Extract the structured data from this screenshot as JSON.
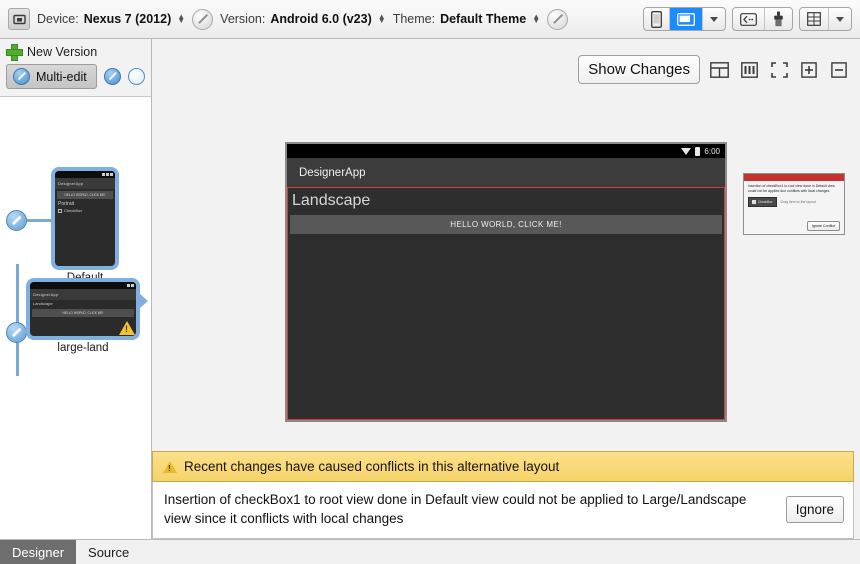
{
  "toolbar": {
    "device_label": "Device:",
    "device_value": "Nexus 7 (2012)",
    "version_label": "Version:",
    "version_value": "Android 6.0 (v23)",
    "theme_label": "Theme:",
    "theme_value": "Default Theme",
    "icons": {
      "device_chooser": "device-icon",
      "version_disabled": "no-entry-icon",
      "theme_disabled": "no-entry-icon",
      "portrait": "portrait-orientation-icon",
      "landscape": "landscape-orientation-icon",
      "orientation_more": "chevron-down-icon",
      "back_nav": "back-navigation-icon",
      "brush": "brush-icon",
      "grid": "grid-icon",
      "grid_more": "chevron-down-icon"
    }
  },
  "sidebar": {
    "new_version_label": "New Version",
    "multi_edit_label": "Multi-edit",
    "variants": [
      {
        "name": "Default",
        "app_title": "DesignerApp",
        "button_text": "HELLO WORLD, CLICK ME!",
        "text": "Portrait",
        "checkbox_label": "CheckBox",
        "has_warning": false
      },
      {
        "name": "large-land",
        "app_title": "DesignerApp",
        "text": "Landscape",
        "button_text": "HELLO WORLD, CLICK ME!",
        "has_warning": true
      }
    ]
  },
  "canvas": {
    "show_changes_label": "Show Changes",
    "tool_icons": [
      "split-view-icon",
      "compare-view-icon",
      "fit-to-screen-icon",
      "zoom-in-icon",
      "zoom-out-icon"
    ]
  },
  "preview": {
    "status_time": "6:00",
    "app_title": "DesignerApp",
    "root_text": "Landscape",
    "button_text": "HELLO WORLD, CLICK ME!"
  },
  "popup": {
    "message": "Insertion of checkBox1 to root view done in Default view could not be applied due conflicts with local changes",
    "chip_label": "CheckBox",
    "drag_hint": "Drag item to the layout",
    "ignore_label": "Ignore Conflict"
  },
  "warning": {
    "title": "Recent changes have caused conflicts in this alternative layout",
    "message": "Insertion of checkBox1 to root view done in Default view could not be applied to Large/Landscape view since it conflicts with local changes",
    "ignore_label": "Ignore"
  },
  "tabs": [
    {
      "label": "Designer",
      "active": true
    },
    {
      "label": "Source",
      "active": false
    }
  ],
  "colors": {
    "accent_blue": "#1a8cff",
    "warning_yellow": "#f6d36a",
    "selection_red": "#d33b3b",
    "node_blue": "#7fb0e0"
  }
}
